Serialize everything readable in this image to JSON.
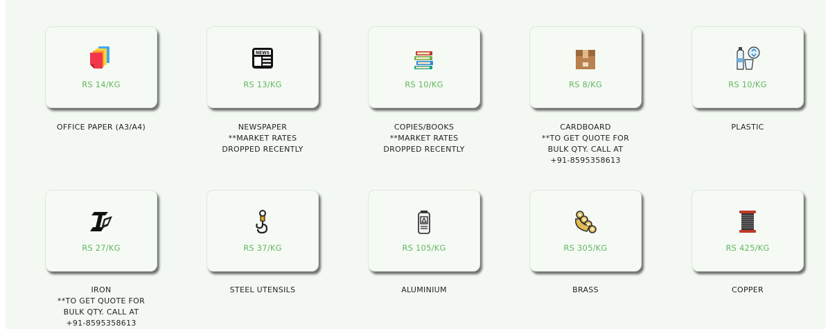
{
  "items": [
    {
      "icon": "paper-stack-icon",
      "price": "RS 14/KG",
      "lines": [
        "OFFICE PAPER (A3/A4)"
      ]
    },
    {
      "icon": "newspaper-icon",
      "price": "RS 13/KG",
      "lines": [
        "NEWSPAPER",
        "**MARKET RATES",
        "DROPPED RECENTLY"
      ]
    },
    {
      "icon": "books-icon",
      "price": "RS 10/KG",
      "lines": [
        "COPIES/BOOKS",
        "**MARKET RATES",
        "DROPPED RECENTLY"
      ]
    },
    {
      "icon": "cardboard-box-icon",
      "price": "RS 8/KG",
      "lines": [
        "CARDBOARD",
        "**TO GET QUOTE FOR",
        "BULK QTY. CALL AT",
        "+91-8595358613"
      ]
    },
    {
      "icon": "plastic-bottle-icon",
      "price": "RS 10/KG",
      "lines": [
        "PLASTIC"
      ]
    },
    {
      "icon": "iron-beam-icon",
      "price": "RS 27/KG",
      "lines": [
        "IRON",
        "**TO GET QUOTE FOR",
        "BULK QTY. CALL AT",
        "+91-8595358613"
      ]
    },
    {
      "icon": "steel-hook-icon",
      "price": "RS 37/KG",
      "lines": [
        "STEEL UTENSILS"
      ]
    },
    {
      "icon": "aluminium-can-icon",
      "price": "RS 105/KG",
      "lines": [
        "ALUMINIUM"
      ]
    },
    {
      "icon": "brass-knuckles-icon",
      "price": "RS 305/KG",
      "lines": [
        "BRASS"
      ]
    },
    {
      "icon": "copper-wire-spool-icon",
      "price": "RS 425/KG",
      "lines": [
        "COPPER"
      ]
    }
  ],
  "colors": {
    "price": "#66b466",
    "panel": "#f3f9f2"
  }
}
